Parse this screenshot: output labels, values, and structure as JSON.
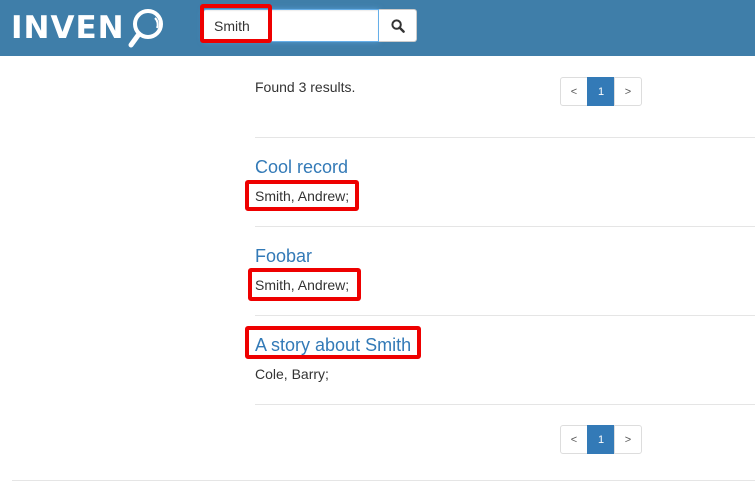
{
  "header": {
    "logo_text": "INVEN",
    "logo_icon": "magnifier-icon",
    "search": {
      "value": "Smith",
      "placeholder": ""
    },
    "search_button_icon": "search-icon"
  },
  "results": {
    "count_text": "Found 3 results.",
    "pagination": {
      "prev": "<",
      "current": "1",
      "next": ">"
    },
    "records": [
      {
        "title": "Cool record",
        "authors": "Smith, Andrew;"
      },
      {
        "title": "Foobar",
        "authors": "Smith, Andrew;"
      },
      {
        "title": "A story about Smith",
        "authors": "Cole, Barry;"
      }
    ]
  },
  "colors": {
    "navbar": "#3f7ea9",
    "link": "#337ab7",
    "highlight": "#ee0000"
  }
}
